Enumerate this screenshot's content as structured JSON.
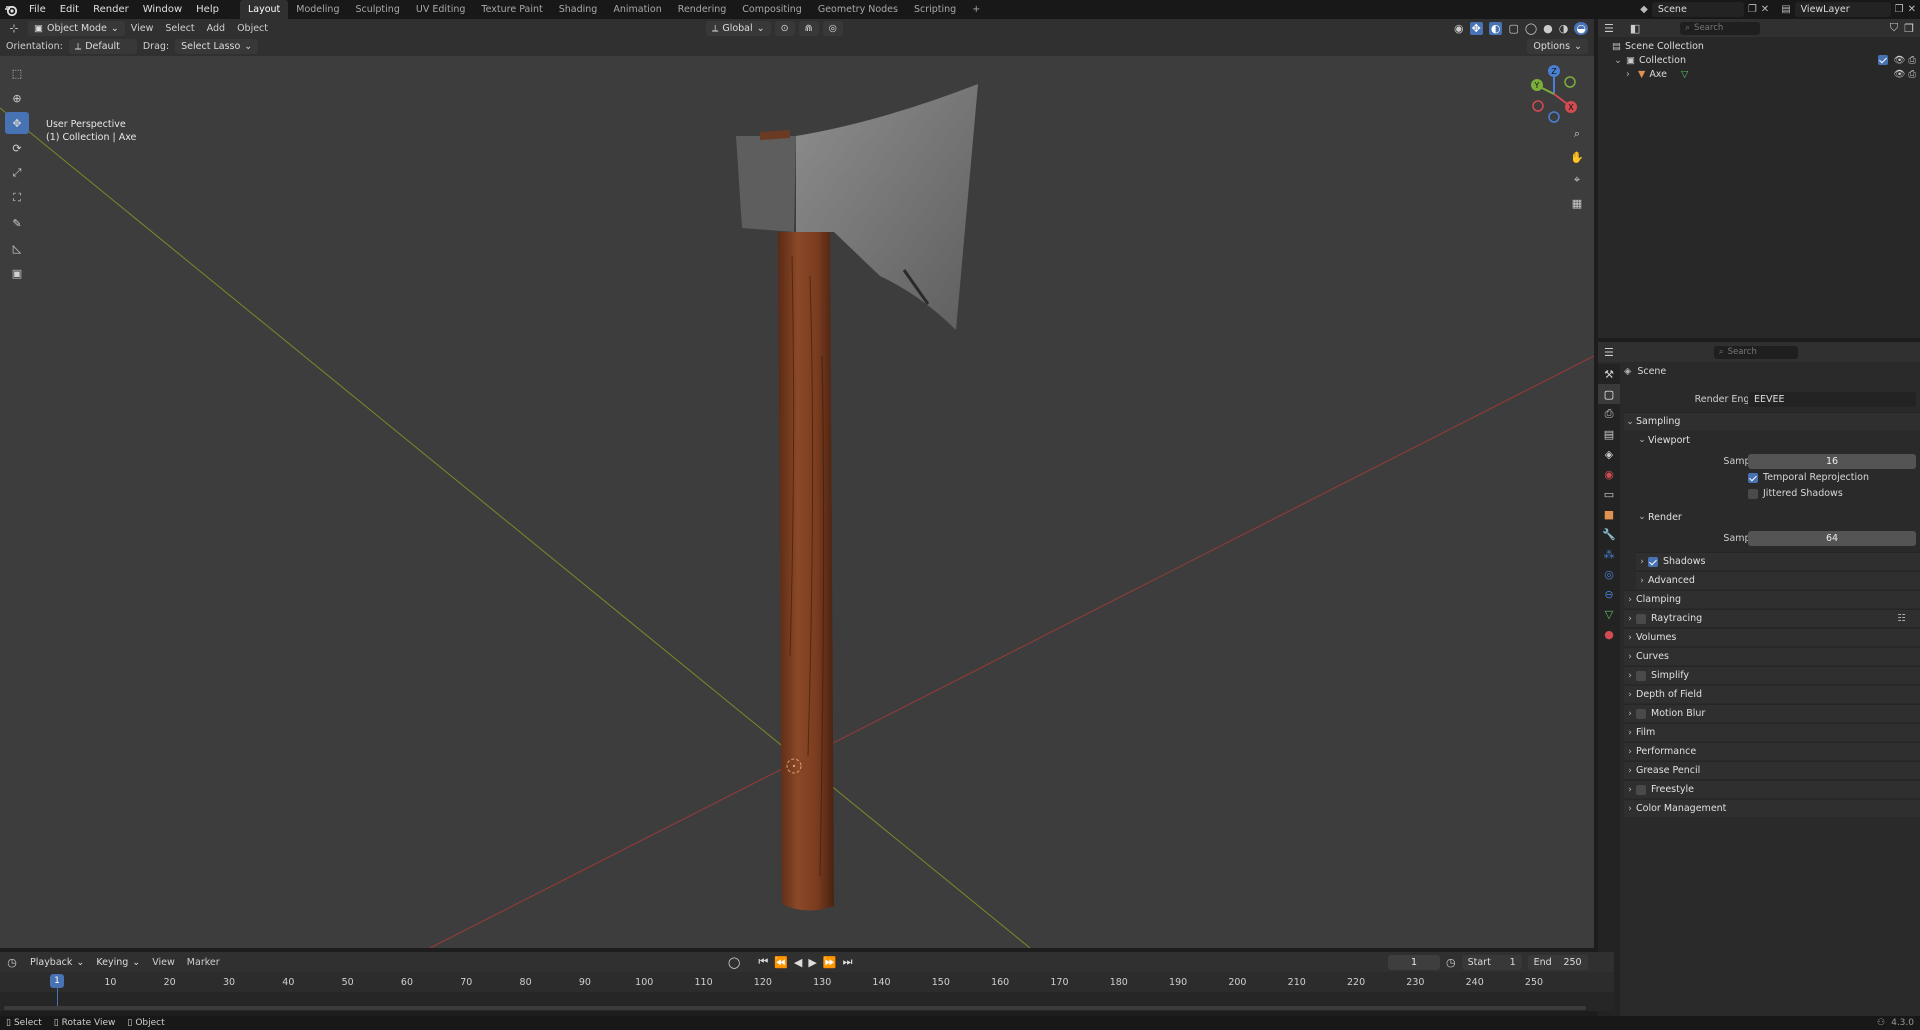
{
  "menu": {
    "items": [
      "File",
      "Edit",
      "Render",
      "Window",
      "Help"
    ]
  },
  "workspaces": {
    "tabs": [
      "Layout",
      "Modeling",
      "Sculpting",
      "UV Editing",
      "Texture Paint",
      "Shading",
      "Animation",
      "Rendering",
      "Compositing",
      "Geometry Nodes",
      "Scripting"
    ],
    "add": "+"
  },
  "topright": {
    "scene": "Scene",
    "viewlayer": "ViewLayer"
  },
  "header3d": {
    "mode": "Object Mode",
    "view": "View",
    "select": "Select",
    "add": "Add",
    "object": "Object",
    "transform": "Global"
  },
  "toolsettings": {
    "orientation_label": "Orientation:",
    "orientation": "Default",
    "drag_label": "Drag:",
    "drag": "Select Lasso",
    "options": "Options"
  },
  "viewport": {
    "perspective": "User Perspective",
    "collection": "(1) Collection | Axe",
    "gizmo": {
      "z": "Z",
      "y": "Y",
      "x": "X"
    }
  },
  "outliner": {
    "search": "Search",
    "root": "Scene Collection",
    "collection": "Collection",
    "object": "Axe"
  },
  "properties": {
    "search": "Search",
    "context": "Scene",
    "render_engine_label": "Render Engine",
    "render_engine": "EEVEE",
    "sampling": "Sampling",
    "viewport": "Viewport",
    "samples_label": "Samples",
    "viewport_samples": "16",
    "temporal_reprojection": "Temporal Reprojection",
    "jittered_shadows": "Jittered Shadows",
    "render": "Render",
    "render_samples": "64",
    "shadows": "Shadows",
    "advanced": "Advanced",
    "panels": [
      "Clamping",
      "Raytracing",
      "Volumes",
      "Curves",
      "Simplify",
      "Depth of Field",
      "Motion Blur",
      "Film",
      "Performance",
      "Grease Pencil",
      "Freestyle",
      "Color Management"
    ]
  },
  "timeline": {
    "playback": "Playback",
    "keying": "Keying",
    "view": "View",
    "marker": "Marker",
    "current_frame": "1",
    "start_label": "Start",
    "start": "1",
    "end_label": "End",
    "end": "250",
    "ticks": [
      "10",
      "20",
      "30",
      "40",
      "50",
      "60",
      "70",
      "80",
      "90",
      "100",
      "110",
      "120",
      "130",
      "140",
      "150",
      "160",
      "170",
      "180",
      "190",
      "200",
      "210",
      "220",
      "230",
      "240",
      "250"
    ],
    "playhead": "1"
  },
  "statusbar": {
    "select": "Select",
    "rotate": "Rotate View",
    "object": "Object",
    "version": "4.3.0"
  }
}
